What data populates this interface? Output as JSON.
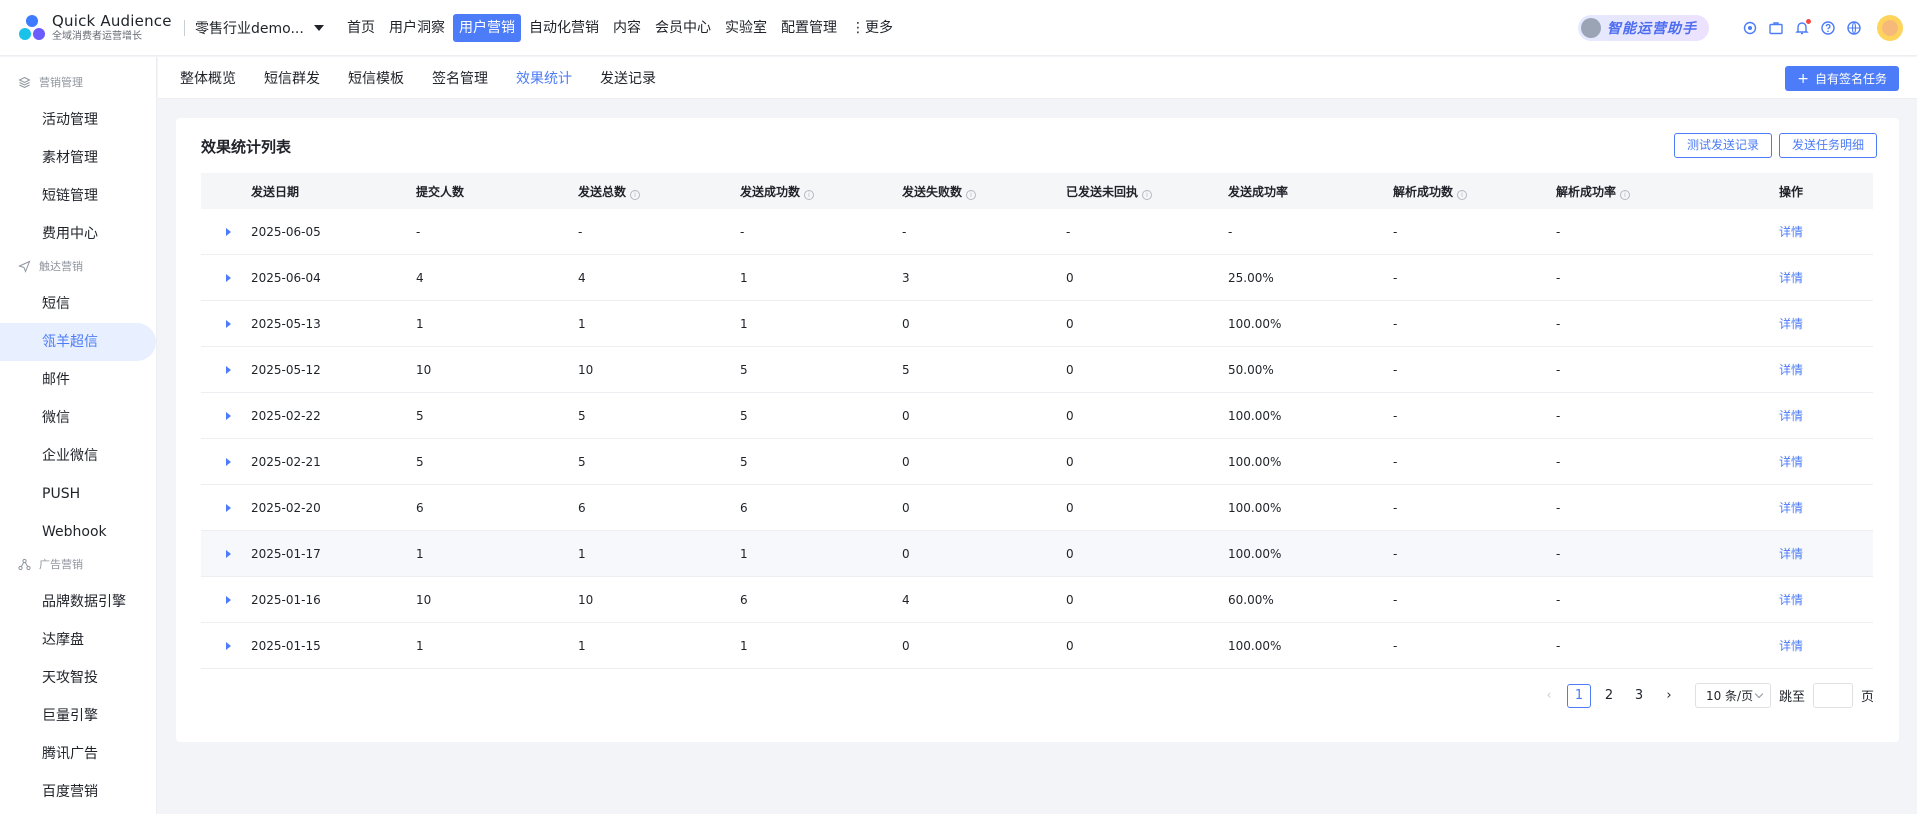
{
  "app": {
    "title": "Quick Audience",
    "subtitle": "全域消费者运营增长",
    "tenant": "零售行业demo..."
  },
  "nav": {
    "items": [
      "首页",
      "用户洞察",
      "用户营销",
      "自动化营销",
      "内容",
      "会员中心",
      "实验室",
      "配置管理"
    ],
    "active_index": 2,
    "more": "更多"
  },
  "assistant": {
    "label": "智能运营助手"
  },
  "icons": [
    "app-icon",
    "briefcase-icon",
    "bell-icon",
    "help-icon",
    "globe-icon"
  ],
  "sidebar": {
    "groups": [
      {
        "title": "营销管理",
        "icon": "layers-icon",
        "items": [
          "活动管理",
          "素材管理",
          "短链管理",
          "费用中心"
        ]
      },
      {
        "title": "触达营销",
        "icon": "send-icon",
        "items": [
          "短信",
          "瓴羊超信",
          "邮件",
          "微信",
          "企业微信",
          "PUSH",
          "Webhook"
        ]
      },
      {
        "title": "广告营销",
        "icon": "share-icon",
        "items": [
          "品牌数据引擎",
          "达摩盘",
          "天攻智投",
          "巨量引擎",
          "腾讯广告",
          "百度营销"
        ]
      }
    ],
    "active_item": "瓴羊超信"
  },
  "subtabs": {
    "items": [
      "整体概览",
      "短信群发",
      "短信模板",
      "签名管理",
      "效果统计",
      "发送记录"
    ],
    "active_index": 4
  },
  "primary_button": "自有签名任务",
  "card": {
    "title": "效果统计列表",
    "btn_test": "测试发送记录",
    "btn_task": "发送任务明细"
  },
  "table": {
    "columns": [
      "发送日期",
      "提交人数",
      "发送总数",
      "发送成功数",
      "发送失败数",
      "已发送未回执",
      "发送成功率",
      "解析成功数",
      "解析成功率",
      "操作"
    ],
    "info_columns": [
      2,
      3,
      4,
      5,
      7,
      8
    ],
    "rows": [
      [
        "2025-06-05",
        "-",
        "-",
        "-",
        "-",
        "-",
        "-",
        "-",
        "-",
        "详情"
      ],
      [
        "2025-06-04",
        "4",
        "4",
        "1",
        "3",
        "0",
        "25.00%",
        "-",
        "-",
        "详情"
      ],
      [
        "2025-05-13",
        "1",
        "1",
        "1",
        "0",
        "0",
        "100.00%",
        "-",
        "-",
        "详情"
      ],
      [
        "2025-05-12",
        "10",
        "10",
        "5",
        "5",
        "0",
        "50.00%",
        "-",
        "-",
        "详情"
      ],
      [
        "2025-02-22",
        "5",
        "5",
        "5",
        "0",
        "0",
        "100.00%",
        "-",
        "-",
        "详情"
      ],
      [
        "2025-02-21",
        "5",
        "5",
        "5",
        "0",
        "0",
        "100.00%",
        "-",
        "-",
        "详情"
      ],
      [
        "2025-02-20",
        "6",
        "6",
        "6",
        "0",
        "0",
        "100.00%",
        "-",
        "-",
        "详情"
      ],
      [
        "2025-01-17",
        "1",
        "1",
        "1",
        "0",
        "0",
        "100.00%",
        "-",
        "-",
        "详情"
      ],
      [
        "2025-01-16",
        "10",
        "10",
        "6",
        "4",
        "0",
        "60.00%",
        "-",
        "-",
        "详情"
      ],
      [
        "2025-01-15",
        "1",
        "1",
        "1",
        "0",
        "0",
        "100.00%",
        "-",
        "-",
        "详情"
      ]
    ],
    "highlighted_row": 7
  },
  "pagination": {
    "pages": [
      "1",
      "2",
      "3"
    ],
    "current": "1",
    "page_size": "10 条/页",
    "jump_label": "跳至",
    "page_unit": "页"
  },
  "colors": {
    "accent": "#4c7cf7",
    "text": "#1f2329",
    "muted": "#8f959e",
    "background": "#f2f4f7"
  }
}
